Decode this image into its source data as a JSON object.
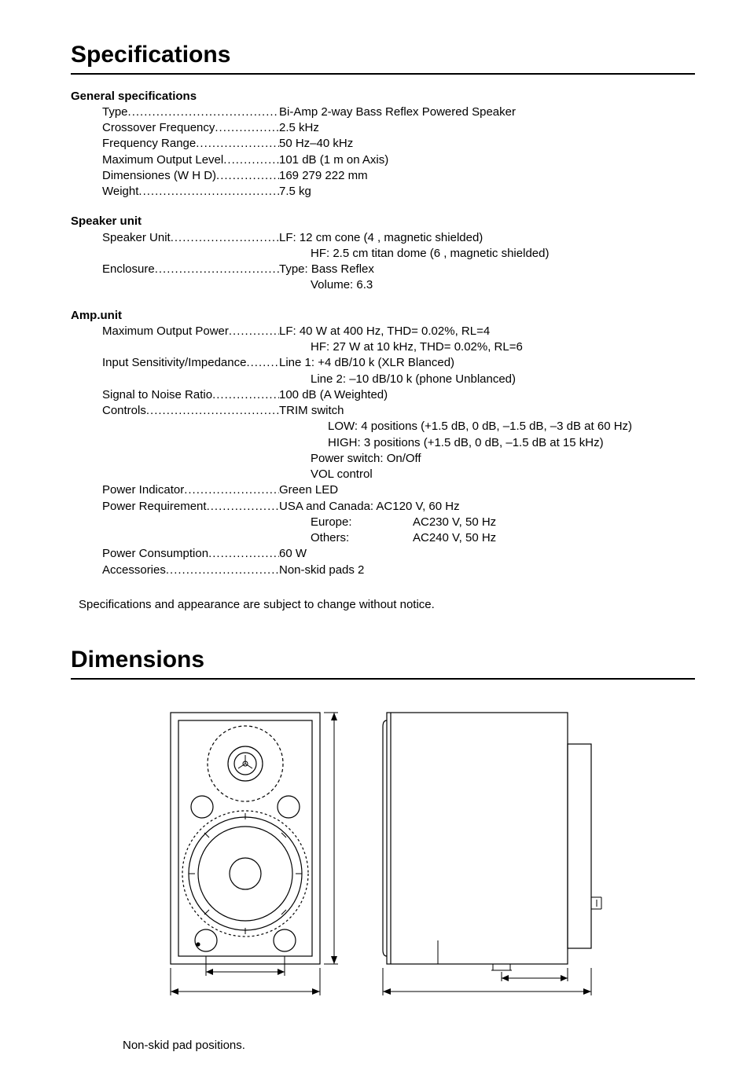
{
  "headings": {
    "specifications": "Specifications",
    "dimensions": "Dimensions"
  },
  "sections": {
    "general": {
      "title": "General specifications",
      "type": {
        "label": "Type",
        "value": "Bi-Amp 2-way Bass Reflex Powered Speaker"
      },
      "crossover": {
        "label": "Crossover Frequency",
        "value": "2.5 kHz"
      },
      "freqRange": {
        "label": "Frequency Range",
        "value": "50 Hz–40 kHz"
      },
      "maxOutput": {
        "label": "Maximum Output Level",
        "value": "101 dB (1 m on Axis)"
      },
      "dimensions": {
        "label": "Dimensiones (W   H   D)",
        "value": "169   279   222 mm"
      },
      "weight": {
        "label": "Weight",
        "value": "7.5 kg"
      }
    },
    "speaker": {
      "title": "Speaker unit",
      "unit": {
        "label": "Speaker Unit",
        "lf": "LF:  12 cm cone (4 , magnetic shielded)",
        "hf": "HF: 2.5 cm titan dome (6 , magnetic shielded)"
      },
      "enclosure": {
        "label": "Enclosure",
        "type": "Type: Bass Reflex",
        "volume": "Volume: 6.3"
      }
    },
    "amp": {
      "title": "Amp.unit",
      "maxPower": {
        "label": "Maximum Output Power",
        "lf": "LF:  40 W at 400 Hz, THD= 0.02%, RL=4",
        "hf": "HF: 27 W at 10 kHz, THD= 0.02%, RL=6"
      },
      "input": {
        "label": "Input Sensitivity/Impedance",
        "l1": "Line 1: +4 dB/10 k  (XLR Blanced)",
        "l2": "Line 2: –10 dB/10 k  (phone Unblanced)"
      },
      "snr": {
        "label": "Signal to Noise Ratio",
        "value": "100 dB (A  Weighted)"
      },
      "controls": {
        "label": "Controls",
        "trim": "TRIM switch",
        "low": "LOW:  4 positions (+1.5 dB, 0 dB, –1.5 dB, –3 dB at 60 Hz)",
        "high": "HIGH: 3 positions (+1.5 dB, 0 dB, –1.5 dB at 15 kHz)",
        "power": "Power switch: On/Off",
        "vol": "VOL control"
      },
      "indicator": {
        "label": "Power Indicator",
        "value": "Green LED"
      },
      "req": {
        "label": "Power Requirement",
        "usa": "USA and Canada: AC120 V, 60 Hz",
        "euLabel": "Europe:",
        "euVal": "AC230 V, 50 Hz",
        "othLabel": "Others:",
        "othVal": "AC240 V, 50 Hz"
      },
      "consumption": {
        "label": "Power Consumption",
        "value": "60 W"
      },
      "accessories": {
        "label": "Accessories",
        "value": "Non-skid pads   2"
      }
    }
  },
  "notes": {
    "disclaimer": "Specifications and appearance are subject to change without notice.",
    "caption": "Non-skid pad positions."
  }
}
